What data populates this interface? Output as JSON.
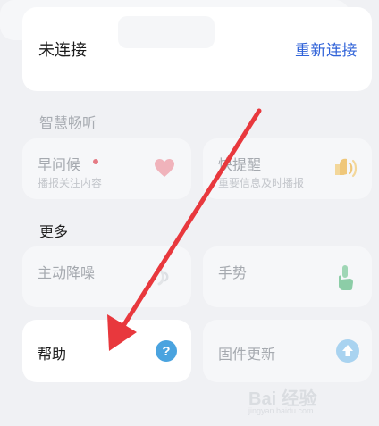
{
  "connection": {
    "status_text": "未连接",
    "reconnect_label": "重新连接",
    "accent_color": "#2f62d8"
  },
  "smart_listening": {
    "section_title": "智慧畅听",
    "morning_greeting": {
      "title": "早问候",
      "subtitle": "播报关注内容",
      "icon": "heart-icon",
      "badge_color": "#e57a84"
    },
    "quick_reminder": {
      "title": "快提醒",
      "subtitle": "重要信息及时播报",
      "icon": "bell-icon"
    }
  },
  "more": {
    "section_title": "更多",
    "noise_cancel": {
      "title": "主动降噪",
      "icon": "sound-wave-icon"
    },
    "gestures": {
      "title": "手势",
      "icon": "hand-icon"
    },
    "help": {
      "title": "帮助",
      "icon": "question-mark-icon",
      "icon_color": "#4aa3df"
    },
    "firmware_update": {
      "title": "固件更新",
      "icon": "upload-arrow-icon"
    }
  },
  "watermark": {
    "brand": "Bai 经验",
    "sub": "jingyan.baidu.com"
  },
  "annotation_arrow_color": "#e8383d"
}
